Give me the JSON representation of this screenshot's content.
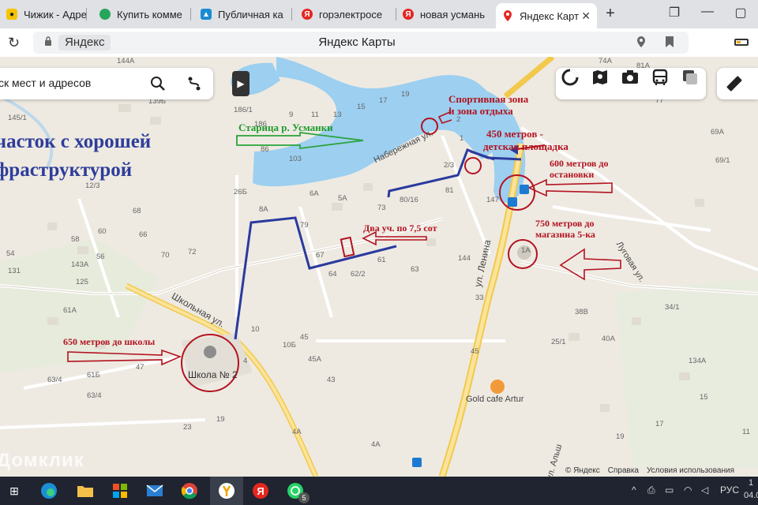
{
  "browser": {
    "tabs": [
      {
        "label": "Чижик - Адрес",
        "icon": "chizhik-icon",
        "active": false
      },
      {
        "label": "Купить комме",
        "icon": "domclick-icon",
        "active": false
      },
      {
        "label": "Публичная ка",
        "icon": "pkk-icon",
        "active": false
      },
      {
        "label": "горэлектросе",
        "icon": "yandex-icon",
        "active": false
      },
      {
        "label": "новая усмань",
        "icon": "yandex-icon",
        "active": false
      },
      {
        "label": "Яндекс Карт",
        "icon": "yandex-maps-icon",
        "active": true
      }
    ],
    "new_tab": "+",
    "address_badge": "Яндекс",
    "page_title": "Яндекс Карты"
  },
  "map": {
    "search_placeholder": "ск мест и адресов",
    "footer": {
      "copyright": "© Яндекс",
      "help": "Справка",
      "terms": "Условия использования"
    },
    "watermark": "Домклик",
    "annotations": {
      "title_line1": "часток с хорошей",
      "title_line2": "фраструктурой",
      "river": "Старица р. Усманки",
      "sport_line1": "Спортивная зона",
      "sport_line2": "и зона отдыха",
      "playground_line1": "450 метров -",
      "playground_line2": "детская площадка",
      "bus_line1": "600 метров до",
      "bus_line2": "остановки",
      "plots": "Два уч. по 7,5 сот",
      "shop_line1": "750 метров до",
      "shop_line2": "магазина  5-ка",
      "school": "650 метров до школы"
    },
    "streets": {
      "naberezhnaya": "Набережная ул.",
      "lenina": "ул. Ленина",
      "shkolnaya": "Школьная ул.",
      "lugovaya": "Луговая ул.",
      "alsh": "ул. Альш"
    },
    "pois": {
      "school": "Школа № 2",
      "cafe": "Gold cafe Artur"
    },
    "house_numbers": [
      {
        "t": "144А"
      },
      {
        "t": "139Б"
      },
      {
        "t": "186/1"
      },
      {
        "t": "186"
      },
      {
        "t": "145/1"
      },
      {
        "t": "12/3"
      },
      {
        "t": "9"
      },
      {
        "t": "11"
      },
      {
        "t": "13"
      },
      {
        "t": "15"
      },
      {
        "t": "17"
      },
      {
        "t": "19"
      },
      {
        "t": "86"
      },
      {
        "t": "103"
      },
      {
        "t": "26Б"
      },
      {
        "t": "6А"
      },
      {
        "t": "5А"
      },
      {
        "t": "73"
      },
      {
        "t": "80/16"
      },
      {
        "t": "81"
      },
      {
        "t": "147"
      },
      {
        "t": "8А"
      },
      {
        "t": "79"
      },
      {
        "t": "67"
      },
      {
        "t": "64"
      },
      {
        "t": "62/2"
      },
      {
        "t": "61"
      },
      {
        "t": "63"
      },
      {
        "t": "144"
      },
      {
        "t": "2"
      },
      {
        "t": "2/3"
      },
      {
        "t": "1"
      },
      {
        "t": "74А"
      },
      {
        "t": "81А"
      },
      {
        "t": "77"
      },
      {
        "t": "69А"
      },
      {
        "t": "69/1"
      },
      {
        "t": "68"
      },
      {
        "t": "66"
      },
      {
        "t": "70"
      },
      {
        "t": "72"
      },
      {
        "t": "60"
      },
      {
        "t": "58"
      },
      {
        "t": "56"
      },
      {
        "t": "54"
      },
      {
        "t": "143А"
      },
      {
        "t": "131"
      },
      {
        "t": "125"
      },
      {
        "t": "61А"
      },
      {
        "t": "61Б"
      },
      {
        "t": "63/4"
      },
      {
        "t": "63/4"
      },
      {
        "t": "4"
      },
      {
        "t": "47"
      },
      {
        "t": "10"
      },
      {
        "t": "10Б"
      },
      {
        "t": "45"
      },
      {
        "t": "45А"
      },
      {
        "t": "43"
      },
      {
        "t": "4А"
      },
      {
        "t": "23"
      },
      {
        "t": "19"
      },
      {
        "t": "4А"
      },
      {
        "t": "38В"
      },
      {
        "t": "34/1"
      },
      {
        "t": "40А"
      },
      {
        "t": "25/1"
      },
      {
        "t": "134А"
      },
      {
        "t": "19"
      },
      {
        "t": "17"
      },
      {
        "t": "15"
      },
      {
        "t": "45"
      },
      {
        "t": "33"
      },
      {
        "t": "1А"
      },
      {
        "t": "11"
      }
    ]
  },
  "taskbar": {
    "apps": [
      {
        "icon": "task-view-icon"
      },
      {
        "icon": "edge-icon"
      },
      {
        "icon": "explorer-icon"
      },
      {
        "icon": "store-icon"
      },
      {
        "icon": "mail-icon"
      },
      {
        "icon": "chrome-icon"
      },
      {
        "icon": "yandex-browser-icon"
      },
      {
        "icon": "yandex-icon"
      },
      {
        "icon": "whatsapp-icon"
      }
    ],
    "whatsapp_badge": "5",
    "language": "РУС",
    "time_fragment": "1",
    "date_fragment": "04.0"
  },
  "colors": {
    "water": "#9ccff0",
    "road_yellow": "#f7d35a",
    "annotation_red": "#b3121f",
    "annotation_blue": "#2e3d9a",
    "annotation_green": "#1f9a2c",
    "route_blue": "#2b3a9e"
  }
}
